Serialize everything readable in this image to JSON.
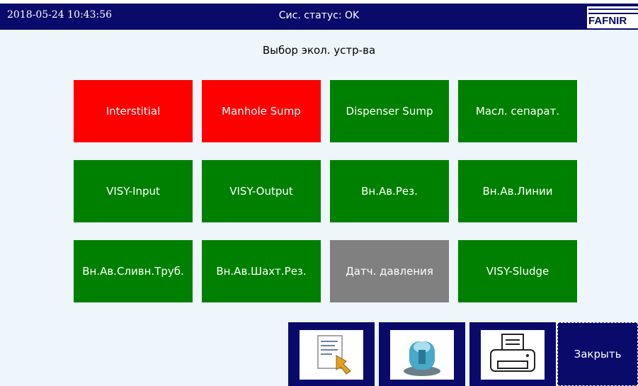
{
  "header": {
    "datetime": "2018-05-24  10:43:56",
    "status": "Сис. статус: OK",
    "logo_text": "FAFNIR"
  },
  "page": {
    "title": "Выбор экол. устр-ва"
  },
  "colors": {
    "header_bg": "#0a0a6b",
    "alarm": "#ff0000",
    "ok": "#008000",
    "inactive": "#808080",
    "content_bg": "#eef5fb"
  },
  "tiles": [
    {
      "label": "Interstitial",
      "state": "alarm"
    },
    {
      "label": "Manhole Sump",
      "state": "alarm"
    },
    {
      "label": "Dispenser Sump",
      "state": "ok"
    },
    {
      "label": "Масл. сепарат.",
      "state": "ok"
    },
    {
      "label": "VISY-Input",
      "state": "ok"
    },
    {
      "label": "VISY-Output",
      "state": "ok"
    },
    {
      "label": "Вн.Ав.Рез.",
      "state": "ok"
    },
    {
      "label": "Вн.Ав.Линии",
      "state": "ok"
    },
    {
      "label": "Вн.Ав.Сливн.Труб.",
      "state": "ok"
    },
    {
      "label": "Вн.Ав.Шахт.Рез.",
      "state": "ok"
    },
    {
      "label": "Датч. давления",
      "state": "inactive"
    },
    {
      "label": "VISY-Sludge",
      "state": "ok"
    }
  ],
  "toolbar": {
    "report_icon": "report-icon",
    "alarm_icon": "alarm-beacon-icon",
    "print_icon": "printer-icon",
    "close_label": "Закрыть"
  }
}
